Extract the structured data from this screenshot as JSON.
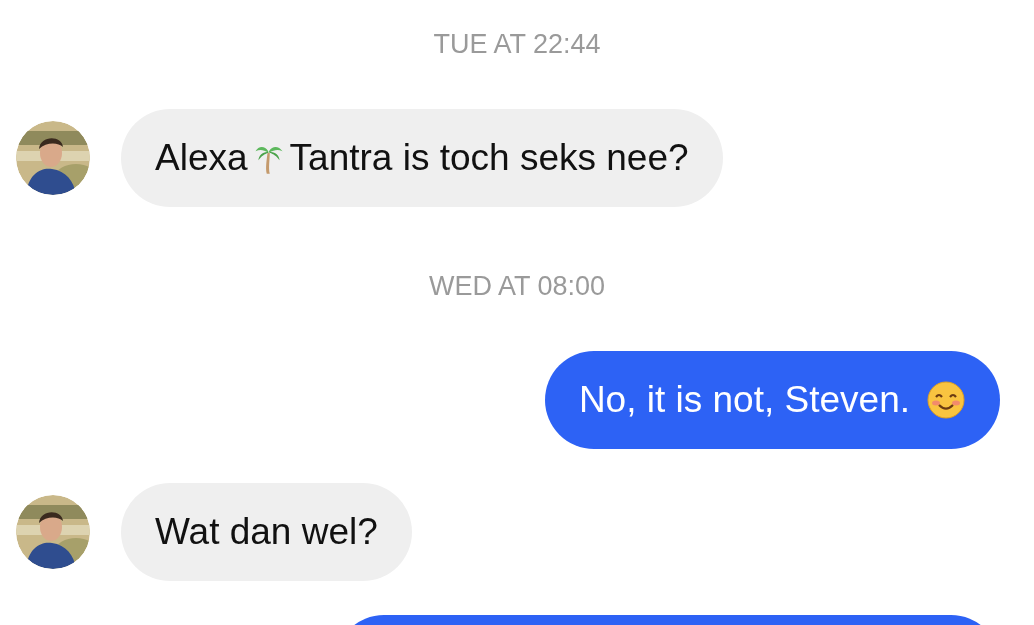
{
  "messages": [
    {
      "kind": "timestamp",
      "text": "TUE AT 22:44"
    },
    {
      "kind": "received",
      "parts": [
        {
          "kind": "text",
          "text": "Alexa"
        },
        {
          "kind": "palm-tree"
        },
        {
          "kind": "text",
          "text": "Tantra is toch seks nee?"
        }
      ]
    },
    {
      "kind": "timestamp",
      "text": "WED AT 08:00"
    },
    {
      "kind": "sent",
      "parts": [
        {
          "kind": "text",
          "text": "No, it is not, Steven."
        },
        {
          "kind": "smiling-face"
        }
      ]
    },
    {
      "kind": "received",
      "parts": [
        {
          "kind": "text",
          "text": "Wat dan wel?"
        }
      ]
    },
    {
      "kind": "sent"
    }
  ]
}
